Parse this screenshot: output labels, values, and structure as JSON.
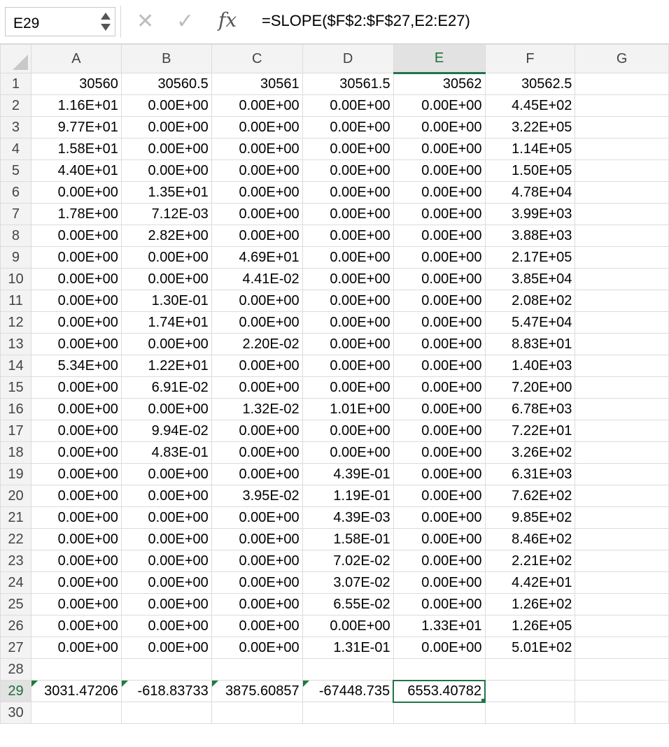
{
  "name_box": {
    "value": "E29"
  },
  "formula_bar": {
    "cancel_icon": "✕",
    "enter_icon": "✓",
    "fx_label": "fx",
    "formula": "=SLOPE($F$2:$F$27,E2:E27)"
  },
  "columns": [
    "A",
    "B",
    "C",
    "D",
    "E",
    "F",
    "G"
  ],
  "selected_cell": {
    "col": "E",
    "row": 29
  },
  "rows": [
    [
      "30560",
      "30560.5",
      "30561",
      "30561.5",
      "30562",
      "30562.5",
      ""
    ],
    [
      "1.16E+01",
      "0.00E+00",
      "0.00E+00",
      "0.00E+00",
      "0.00E+00",
      "4.45E+02",
      ""
    ],
    [
      "9.77E+01",
      "0.00E+00",
      "0.00E+00",
      "0.00E+00",
      "0.00E+00",
      "3.22E+05",
      ""
    ],
    [
      "1.58E+01",
      "0.00E+00",
      "0.00E+00",
      "0.00E+00",
      "0.00E+00",
      "1.14E+05",
      ""
    ],
    [
      "4.40E+01",
      "0.00E+00",
      "0.00E+00",
      "0.00E+00",
      "0.00E+00",
      "1.50E+05",
      ""
    ],
    [
      "0.00E+00",
      "1.35E+01",
      "0.00E+00",
      "0.00E+00",
      "0.00E+00",
      "4.78E+04",
      ""
    ],
    [
      "1.78E+00",
      "7.12E-03",
      "0.00E+00",
      "0.00E+00",
      "0.00E+00",
      "3.99E+03",
      ""
    ],
    [
      "0.00E+00",
      "2.82E+00",
      "0.00E+00",
      "0.00E+00",
      "0.00E+00",
      "3.88E+03",
      ""
    ],
    [
      "0.00E+00",
      "0.00E+00",
      "4.69E+01",
      "0.00E+00",
      "0.00E+00",
      "2.17E+05",
      ""
    ],
    [
      "0.00E+00",
      "0.00E+00",
      "4.41E-02",
      "0.00E+00",
      "0.00E+00",
      "3.85E+04",
      ""
    ],
    [
      "0.00E+00",
      "1.30E-01",
      "0.00E+00",
      "0.00E+00",
      "0.00E+00",
      "2.08E+02",
      ""
    ],
    [
      "0.00E+00",
      "1.74E+01",
      "0.00E+00",
      "0.00E+00",
      "0.00E+00",
      "5.47E+04",
      ""
    ],
    [
      "0.00E+00",
      "0.00E+00",
      "2.20E-02",
      "0.00E+00",
      "0.00E+00",
      "8.83E+01",
      ""
    ],
    [
      "5.34E+00",
      "1.22E+01",
      "0.00E+00",
      "0.00E+00",
      "0.00E+00",
      "1.40E+03",
      ""
    ],
    [
      "0.00E+00",
      "6.91E-02",
      "0.00E+00",
      "0.00E+00",
      "0.00E+00",
      "7.20E+00",
      ""
    ],
    [
      "0.00E+00",
      "0.00E+00",
      "1.32E-02",
      "1.01E+00",
      "0.00E+00",
      "6.78E+03",
      ""
    ],
    [
      "0.00E+00",
      "9.94E-02",
      "0.00E+00",
      "0.00E+00",
      "0.00E+00",
      "7.22E+01",
      ""
    ],
    [
      "0.00E+00",
      "4.83E-01",
      "0.00E+00",
      "0.00E+00",
      "0.00E+00",
      "3.26E+02",
      ""
    ],
    [
      "0.00E+00",
      "0.00E+00",
      "0.00E+00",
      "4.39E-01",
      "0.00E+00",
      "6.31E+03",
      ""
    ],
    [
      "0.00E+00",
      "0.00E+00",
      "3.95E-02",
      "1.19E-01",
      "0.00E+00",
      "7.62E+02",
      ""
    ],
    [
      "0.00E+00",
      "0.00E+00",
      "0.00E+00",
      "4.39E-03",
      "0.00E+00",
      "9.85E+02",
      ""
    ],
    [
      "0.00E+00",
      "0.00E+00",
      "0.00E+00",
      "1.58E-01",
      "0.00E+00",
      "8.46E+02",
      ""
    ],
    [
      "0.00E+00",
      "0.00E+00",
      "0.00E+00",
      "7.02E-02",
      "0.00E+00",
      "2.21E+02",
      ""
    ],
    [
      "0.00E+00",
      "0.00E+00",
      "0.00E+00",
      "3.07E-02",
      "0.00E+00",
      "4.42E+01",
      ""
    ],
    [
      "0.00E+00",
      "0.00E+00",
      "0.00E+00",
      "6.55E-02",
      "0.00E+00",
      "1.26E+02",
      ""
    ],
    [
      "0.00E+00",
      "0.00E+00",
      "0.00E+00",
      "0.00E+00",
      "1.33E+01",
      "1.26E+05",
      ""
    ],
    [
      "0.00E+00",
      "0.00E+00",
      "0.00E+00",
      "1.31E-01",
      "0.00E+00",
      "5.01E+02",
      ""
    ],
    [
      "",
      "",
      "",
      "",
      "",
      "",
      ""
    ],
    [
      "3031.47206",
      "-618.83733",
      "3875.60857",
      "-67448.735",
      "6553.40782",
      "",
      ""
    ],
    [
      "",
      "",
      "",
      "",
      "",
      "",
      ""
    ]
  ],
  "error_indicator_cells": [
    "A29",
    "B29",
    "C29",
    "D29"
  ]
}
